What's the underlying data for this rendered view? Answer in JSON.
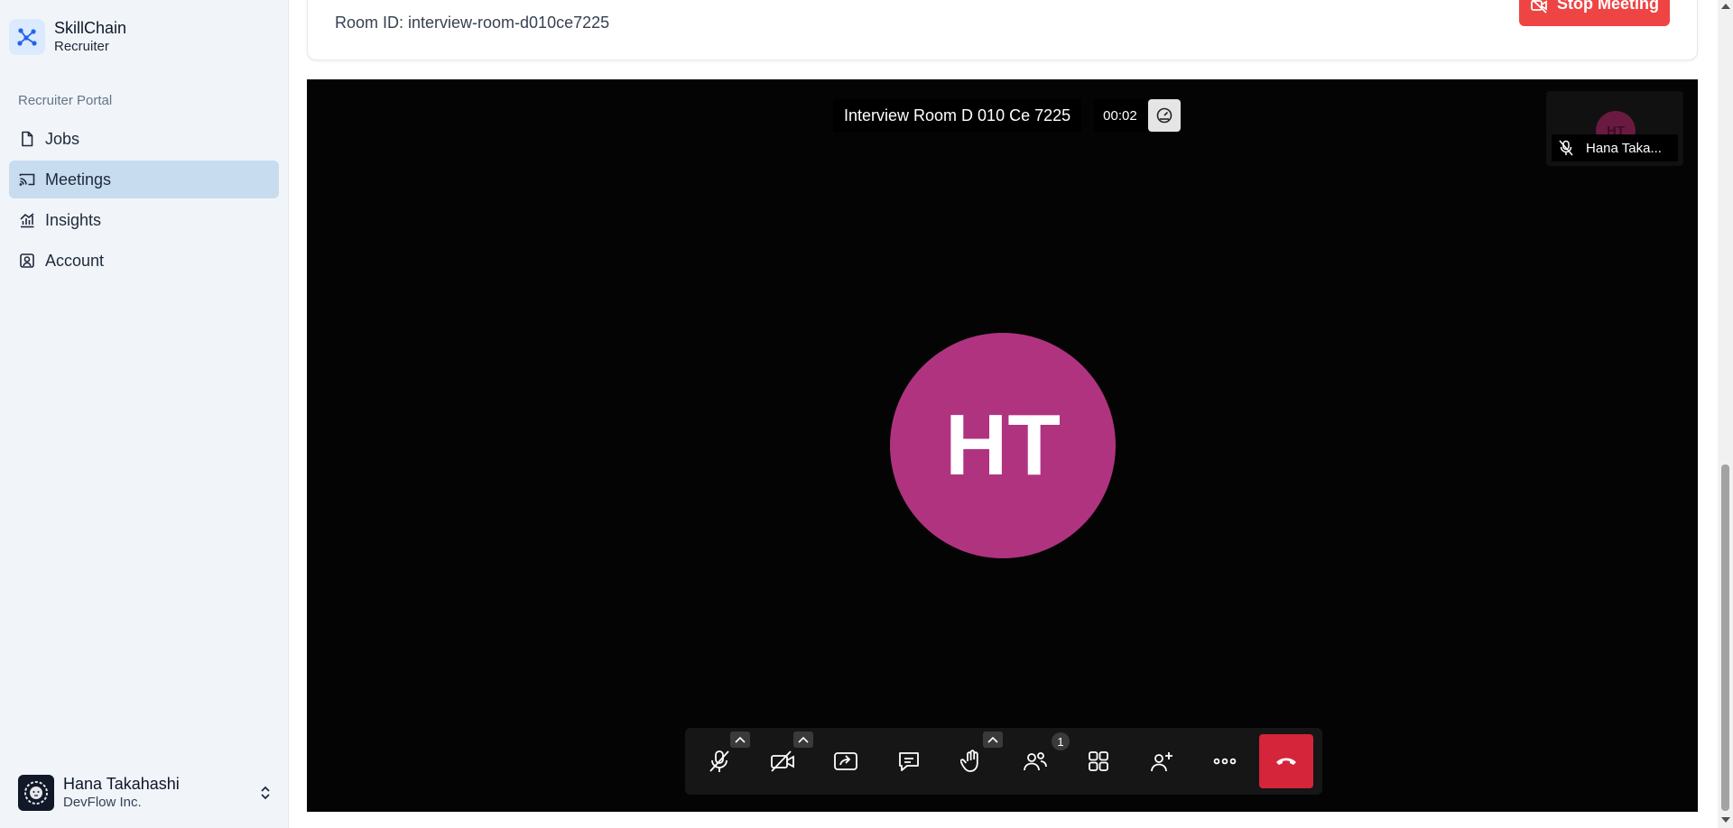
{
  "brand": {
    "name": "SkillChain",
    "subtitle": "Recruiter"
  },
  "sidebar": {
    "group_label": "Recruiter Portal",
    "items": [
      {
        "label": "Jobs",
        "icon": "file-icon",
        "active": false
      },
      {
        "label": "Meetings",
        "icon": "cast-icon",
        "active": true
      },
      {
        "label": "Insights",
        "icon": "chart-icon",
        "active": false
      },
      {
        "label": "Account",
        "icon": "user-square-icon",
        "active": false
      }
    ],
    "user": {
      "name": "Hana Takahashi",
      "org": "DevFlow Inc."
    }
  },
  "meeting": {
    "room_id": "Room ID: interview-room-d010ce7225",
    "stop_label": "Stop Meeting",
    "room_title": "Interview Room D 010 Ce 7225",
    "timer": "00:02",
    "participant_initials": "HT",
    "thumbnail_name": "Hana Taka...",
    "participant_count": "1",
    "avatar_color": "#b03380",
    "hangup_color": "#d4253a"
  },
  "toolbar": {
    "buttons": [
      "microphone-muted",
      "camera-off",
      "share-screen",
      "chat",
      "raise-hand",
      "participants",
      "tile-view",
      "invite",
      "more",
      "hang-up"
    ]
  }
}
